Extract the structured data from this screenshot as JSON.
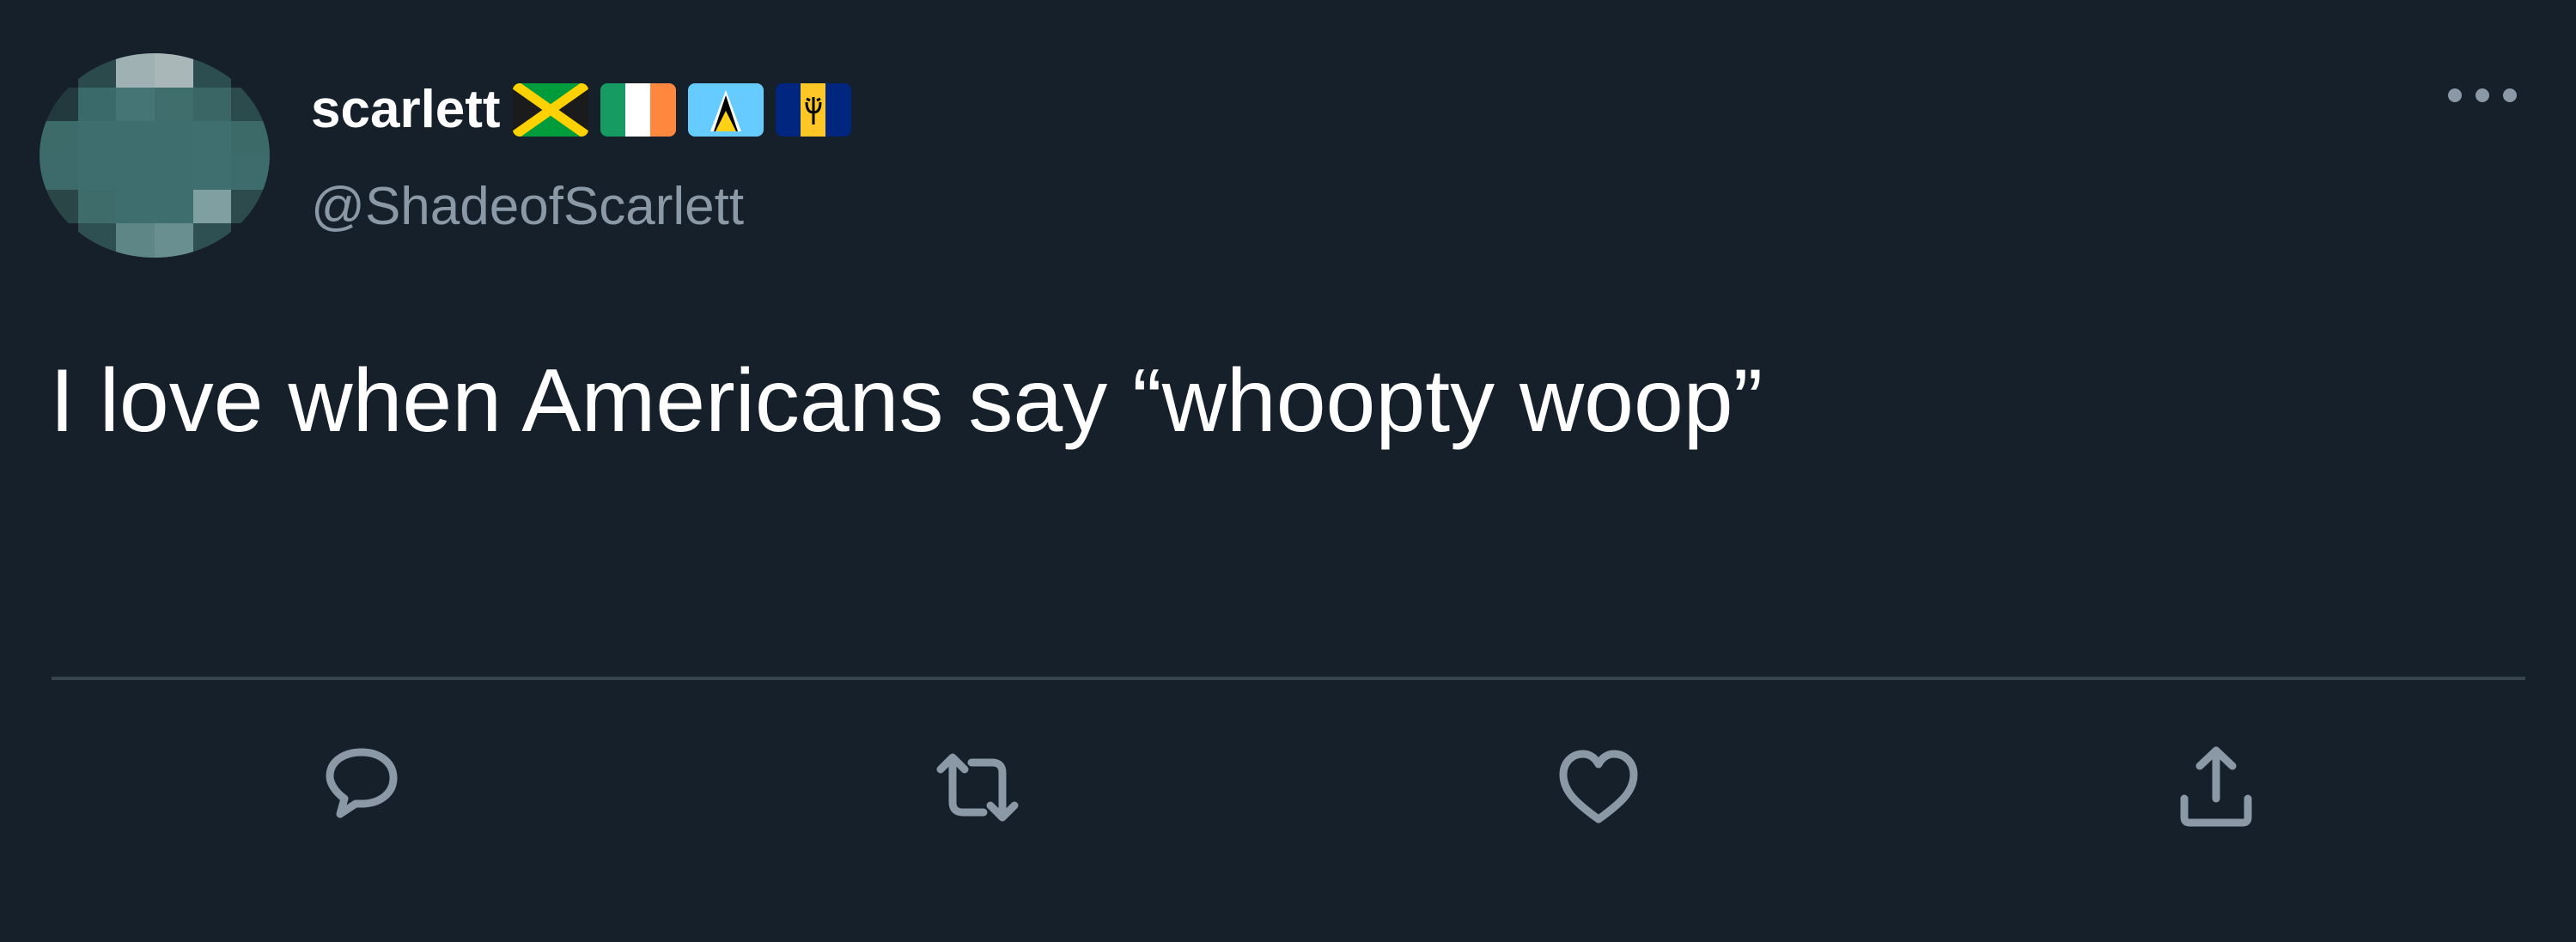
{
  "user": {
    "display_name": "scarlett",
    "handle": "@ShadeofScarlett",
    "flags": [
      "jamaica-flag",
      "ireland-flag",
      "saint-lucia-flag",
      "barbados-flag"
    ]
  },
  "tweet": {
    "text": "I love when Americans say “whoopty woop”"
  },
  "actions": {
    "reply": "reply-icon",
    "retweet": "retweet-icon",
    "like": "like-icon",
    "share": "share-icon"
  },
  "colors": {
    "background": "#15202b",
    "primary_text": "#ffffff",
    "secondary_text": "#8b98a5",
    "divider": "#38444d",
    "avatar_tone": "#3e6f6e"
  }
}
